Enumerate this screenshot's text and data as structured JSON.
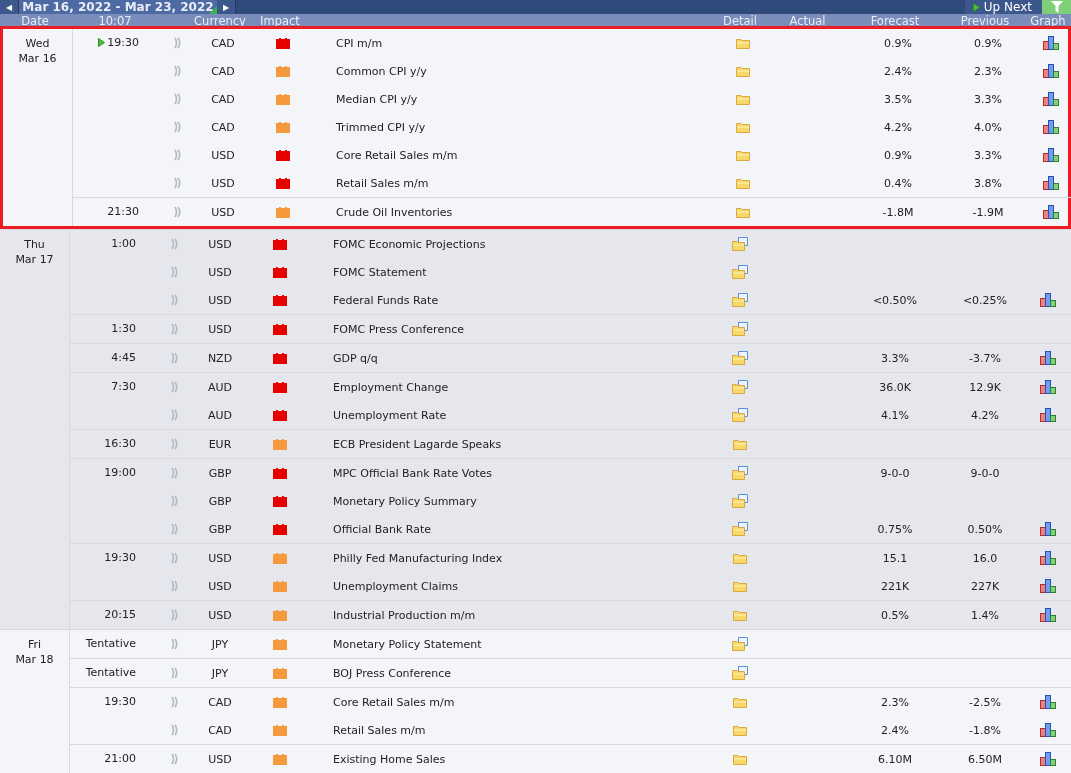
{
  "toolbar": {
    "prev": "◀",
    "range": "Mar 16, 2022 - Mar 23, 2022",
    "next": "▶",
    "up_next": "Up Next"
  },
  "columns": [
    "Date",
    "10:07",
    "Currency",
    "Impact",
    "Detail",
    "Actual",
    "Forecast",
    "Previous",
    "Graph"
  ],
  "days": [
    {
      "weekday": "Wed",
      "date": "Mar 16",
      "highlighted": true,
      "times": [
        {
          "time": "19:30",
          "up_next": true,
          "events": [
            {
              "currency": "CAD",
              "color": "#e60000",
              "title": "CPI m/m",
              "detail_document": false,
              "forecast": "0.9%",
              "previous": "0.9%",
              "graph": true
            },
            {
              "currency": "CAD",
              "color": "#f49a3c",
              "title": "Common CPI y/y",
              "detail_document": false,
              "forecast": "2.4%",
              "previous": "2.3%",
              "graph": true
            },
            {
              "currency": "CAD",
              "color": "#f49a3c",
              "title": "Median CPI y/y",
              "detail_document": false,
              "forecast": "3.5%",
              "previous": "3.3%",
              "graph": true
            },
            {
              "currency": "CAD",
              "color": "#f49a3c",
              "title": "Trimmed CPI y/y",
              "detail_document": false,
              "forecast": "4.2%",
              "previous": "4.0%",
              "graph": true
            },
            {
              "currency": "USD",
              "color": "#e60000",
              "title": "Core Retail Sales m/m",
              "detail_document": false,
              "forecast": "0.9%",
              "previous": "3.3%",
              "graph": true
            },
            {
              "currency": "USD",
              "color": "#e60000",
              "title": "Retail Sales m/m",
              "detail_document": false,
              "forecast": "0.4%",
              "previous": "3.8%",
              "graph": true
            }
          ]
        },
        {
          "time": "21:30",
          "up_next": false,
          "events": [
            {
              "currency": "USD",
              "color": "#f49a3c",
              "title": "Crude Oil Inventories",
              "detail_document": false,
              "forecast": "-1.8M",
              "previous": "-1.9M",
              "graph": true
            }
          ]
        }
      ]
    },
    {
      "weekday": "Thu",
      "date": "Mar 17",
      "highlighted": false,
      "times": [
        {
          "time": "1:00",
          "up_next": false,
          "events": [
            {
              "currency": "USD",
              "color": "#e60000",
              "title": "FOMC Economic Projections",
              "detail_document": true,
              "graph": false
            },
            {
              "currency": "USD",
              "color": "#e60000",
              "title": "FOMC Statement",
              "detail_document": true,
              "graph": false
            },
            {
              "currency": "USD",
              "color": "#e60000",
              "title": "Federal Funds Rate",
              "detail_document": true,
              "forecast": "<0.50%",
              "previous": "<0.25%",
              "graph": true
            }
          ]
        },
        {
          "time": "1:30",
          "up_next": false,
          "events": [
            {
              "currency": "USD",
              "color": "#e60000",
              "title": "FOMC Press Conference",
              "detail_document": true,
              "graph": false
            }
          ]
        },
        {
          "time": "4:45",
          "up_next": false,
          "events": [
            {
              "currency": "NZD",
              "color": "#e60000",
              "title": "GDP q/q",
              "detail_document": true,
              "forecast": "3.3%",
              "previous": "-3.7%",
              "graph": true
            }
          ]
        },
        {
          "time": "7:30",
          "up_next": false,
          "events": [
            {
              "currency": "AUD",
              "color": "#e60000",
              "title": "Employment Change",
              "detail_document": true,
              "forecast": "36.0K",
              "previous": "12.9K",
              "graph": true
            },
            {
              "currency": "AUD",
              "color": "#e60000",
              "title": "Unemployment Rate",
              "detail_document": true,
              "forecast": "4.1%",
              "previous": "4.2%",
              "graph": true
            }
          ]
        },
        {
          "time": "16:30",
          "up_next": false,
          "events": [
            {
              "currency": "EUR",
              "color": "#f49a3c",
              "title": "ECB President Lagarde Speaks",
              "detail_document": false,
              "graph": false
            }
          ]
        },
        {
          "time": "19:00",
          "up_next": false,
          "events": [
            {
              "currency": "GBP",
              "color": "#e60000",
              "title": "MPC Official Bank Rate Votes",
              "detail_document": true,
              "forecast": "9-0-0",
              "previous": "9-0-0",
              "graph": false
            },
            {
              "currency": "GBP",
              "color": "#e60000",
              "title": "Monetary Policy Summary",
              "detail_document": true,
              "graph": false
            },
            {
              "currency": "GBP",
              "color": "#e60000",
              "title": "Official Bank Rate",
              "detail_document": true,
              "forecast": "0.75%",
              "previous": "0.50%",
              "graph": true
            }
          ]
        },
        {
          "time": "19:30",
          "up_next": false,
          "events": [
            {
              "currency": "USD",
              "color": "#f49a3c",
              "title": "Philly Fed Manufacturing Index",
              "detail_document": false,
              "forecast": "15.1",
              "previous": "16.0",
              "graph": true
            },
            {
              "currency": "USD",
              "color": "#f49a3c",
              "title": "Unemployment Claims",
              "detail_document": false,
              "forecast": "221K",
              "previous": "227K",
              "graph": true
            }
          ]
        },
        {
          "time": "20:15",
          "up_next": false,
          "events": [
            {
              "currency": "USD",
              "color": "#f49a3c",
              "title": "Industrial Production m/m",
              "detail_document": false,
              "forecast": "0.5%",
              "previous": "1.4%",
              "graph": true
            }
          ]
        }
      ]
    },
    {
      "weekday": "Fri",
      "date": "Mar 18",
      "highlighted": false,
      "times": [
        {
          "time": "Tentative",
          "up_next": false,
          "events": [
            {
              "currency": "JPY",
              "color": "#f49a3c",
              "title": "Monetary Policy Statement",
              "detail_document": true,
              "graph": false
            }
          ]
        },
        {
          "time": "Tentative",
          "up_next": false,
          "events": [
            {
              "currency": "JPY",
              "color": "#f49a3c",
              "title": "BOJ Press Conference",
              "detail_document": true,
              "graph": false
            }
          ]
        },
        {
          "time": "19:30",
          "up_next": false,
          "events": [
            {
              "currency": "CAD",
              "color": "#f49a3c",
              "title": "Core Retail Sales m/m",
              "detail_document": false,
              "forecast": "2.3%",
              "previous": "-2.5%",
              "graph": true
            },
            {
              "currency": "CAD",
              "color": "#f49a3c",
              "title": "Retail Sales m/m",
              "detail_document": false,
              "forecast": "2.4%",
              "previous": "-1.8%",
              "graph": true
            }
          ]
        },
        {
          "time": "21:00",
          "up_next": false,
          "events": [
            {
              "currency": "USD",
              "color": "#f49a3c",
              "title": "Existing Home Sales",
              "detail_document": false,
              "forecast": "6.10M",
              "previous": "6.50M",
              "graph": true
            }
          ]
        }
      ]
    }
  ]
}
